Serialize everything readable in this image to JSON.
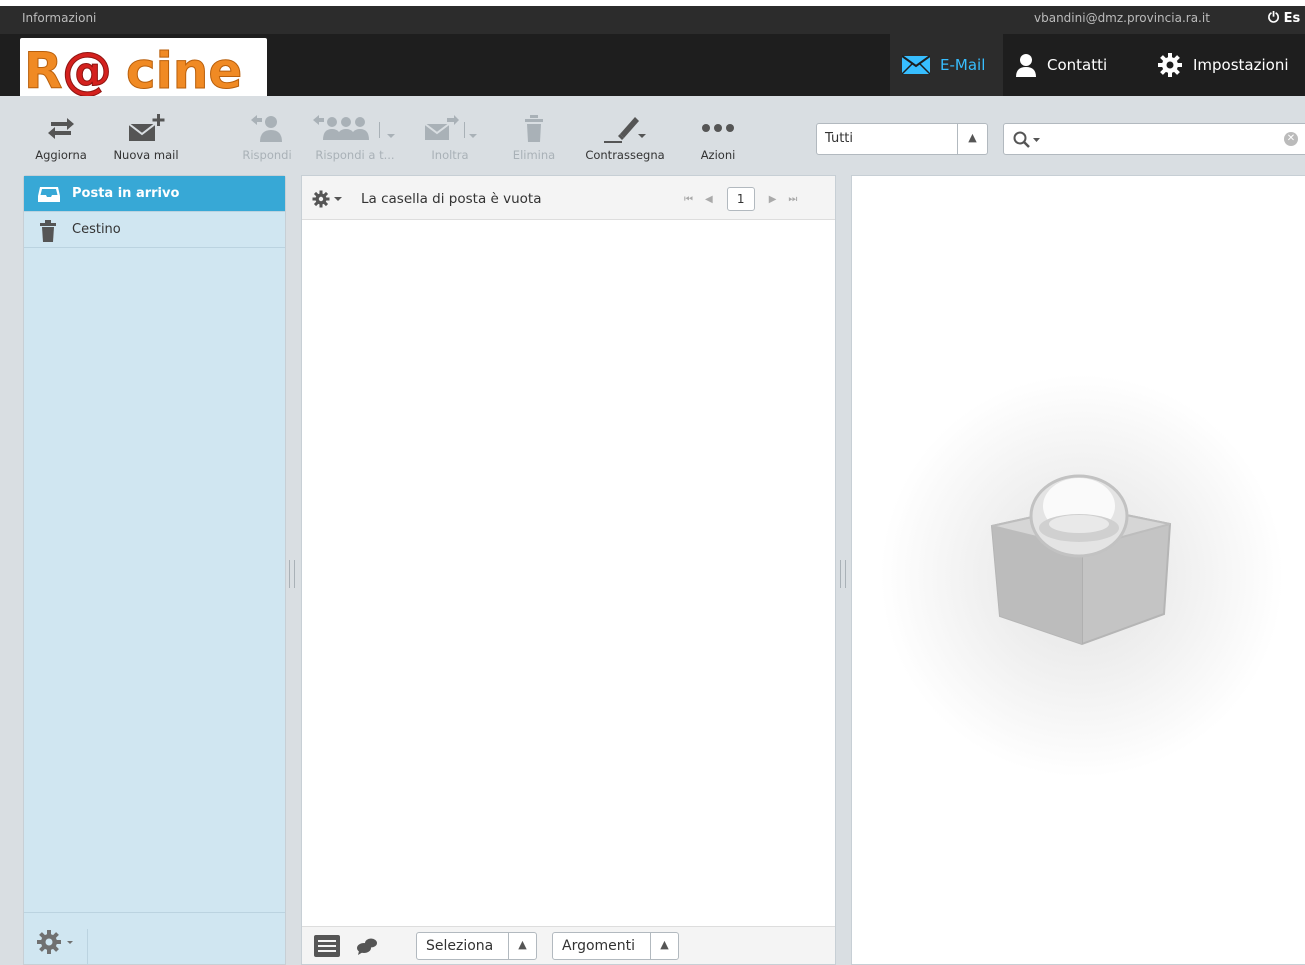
{
  "topline": {
    "about": "Informazioni",
    "username": "vbandini@dmz.provincia.ra.it",
    "logout": "Es"
  },
  "logo": {
    "text": "R@cine"
  },
  "taskbar": [
    {
      "label": "E-Mail",
      "icon": "envelope-icon",
      "active": true
    },
    {
      "label": "Contatti",
      "icon": "person-icon"
    },
    {
      "label": "Impostazioni",
      "icon": "gear-icon"
    }
  ],
  "toolbar": {
    "refresh": "Aggiorna",
    "compose": "Nuova mail",
    "reply": "Rispondi",
    "reply_all": "Rispondi a t...",
    "forward": "Inoltra",
    "delete": "Elimina",
    "mark": "Contrassegna",
    "more": "Azioni"
  },
  "filter": {
    "value": "Tutti"
  },
  "search": {
    "placeholder": ""
  },
  "folders": [
    {
      "label": "Posta in arrivo",
      "icon": "inbox-icon",
      "selected": true
    },
    {
      "label": "Cestino",
      "icon": "trash-icon"
    }
  ],
  "messagelist": {
    "status": "La casella di posta è vuota",
    "page": "1",
    "select_label": "Seleziona",
    "threads_label": "Argomenti"
  },
  "colors": {
    "accent": "#37beff",
    "selected_folder": "#37a8d6",
    "logo_orange": "#f08a24",
    "logo_red": "#d4211e"
  }
}
